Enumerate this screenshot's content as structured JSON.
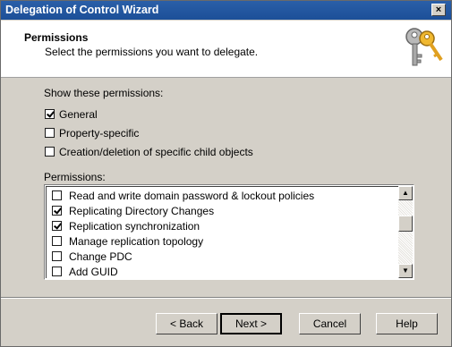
{
  "window": {
    "title": "Delegation of Control Wizard",
    "close_label": "×"
  },
  "header": {
    "title": "Permissions",
    "subtitle": "Select the permissions you want to delegate.",
    "icon": "keys-icon"
  },
  "show_label": "Show these permissions:",
  "filters": [
    {
      "label": "General",
      "checked": true
    },
    {
      "label": "Property-specific",
      "checked": false
    },
    {
      "label": "Creation/deletion of specific child objects",
      "checked": false
    }
  ],
  "permissions_label": "Permissions:",
  "permissions": [
    {
      "label": "Read and write domain password & lockout policies",
      "checked": false
    },
    {
      "label": "Replicating Directory Changes",
      "checked": true
    },
    {
      "label": "Replication synchronization",
      "checked": true
    },
    {
      "label": "Manage replication topology",
      "checked": false
    },
    {
      "label": "Change PDC",
      "checked": false
    },
    {
      "label": "Add GUID",
      "checked": false
    }
  ],
  "buttons": {
    "back": "< Back",
    "next": "Next >",
    "cancel": "Cancel",
    "help": "Help"
  }
}
